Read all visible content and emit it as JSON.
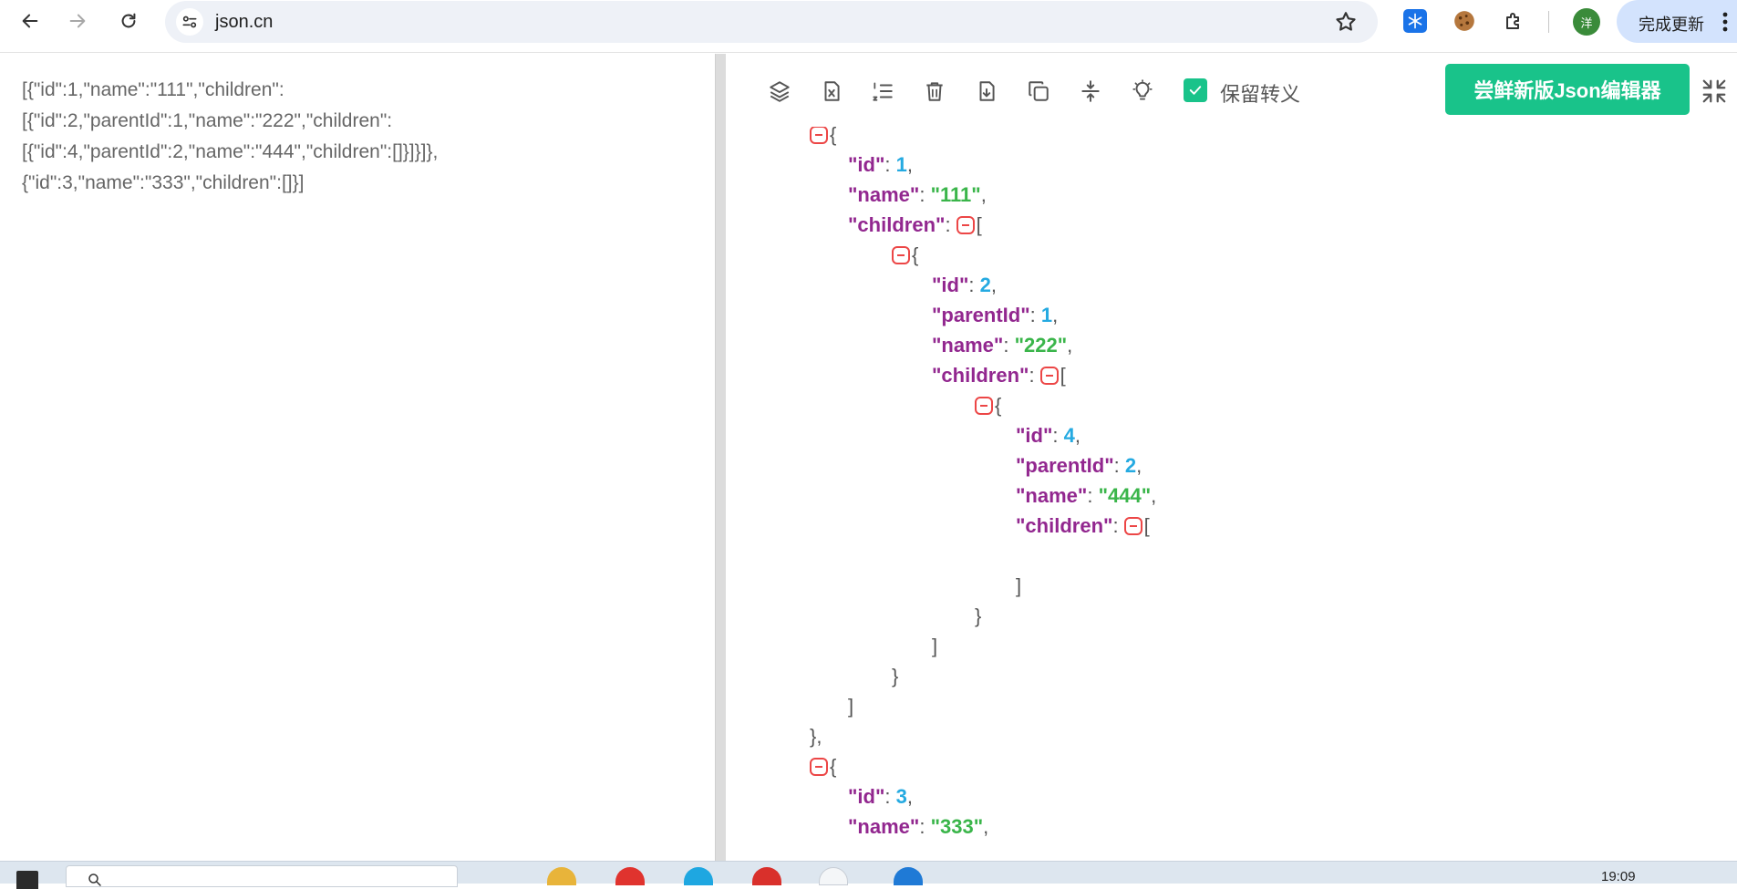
{
  "browser": {
    "url": "json.cn",
    "update_button": "完成更新",
    "avatar_text": "洋"
  },
  "raw_json_lines": [
    "[{\"id\":1,\"name\":\"111\",\"children\":",
    "[{\"id\":2,\"parentId\":1,\"name\":\"222\",\"children\":",
    "[{\"id\":4,\"parentId\":2,\"name\":\"444\",\"children\":[]}]}]},",
    "{\"id\":3,\"name\":\"333\",\"children\":[]}]"
  ],
  "toolbar": {
    "keep_escape_label": "保留转义",
    "keep_escape_checked": true,
    "new_editor_button": "尝鲜新版Json编辑器"
  },
  "tree": {
    "k_id": "\"id\"",
    "k_name": "\"name\"",
    "k_children": "\"children\"",
    "k_parentId": "\"parentId\"",
    "v_1": "1",
    "v_2": "2",
    "v_3": "3",
    "v_4": "4",
    "v_111": "\"111\"",
    "v_222": "\"222\"",
    "v_333": "\"333\"",
    "v_444": "\"444\""
  },
  "taskbar": {
    "time": "19:09"
  },
  "colors": {
    "key": "#92278f",
    "number": "#25aae1",
    "string": "#3ab54a",
    "accent": "#19c38a",
    "toggle": "#ec4646"
  }
}
